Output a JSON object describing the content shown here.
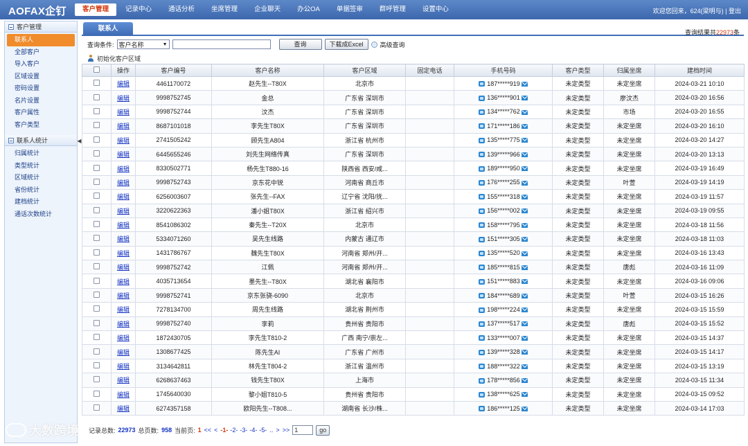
{
  "app": {
    "logo": "AOFAX企钉",
    "welcome": "欢迎您回来，624(梁明与) | 登出"
  },
  "nav": [
    "客户管理",
    "记录中心",
    "通话分析",
    "坐席管理",
    "企业聊天",
    "办公OA",
    "单据签审",
    "群呼管理",
    "设置中心"
  ],
  "sidebar": {
    "group1": {
      "title": "客户管理",
      "items": [
        "联系人",
        "全部客户",
        "导入客户",
        "区域设置",
        "密码设置",
        "名片设置",
        "客户属性",
        "客户类型"
      ]
    },
    "group2": {
      "title": "联系人统计",
      "items": [
        "归属统计",
        "类型统计",
        "区域统计",
        "省份统计",
        "建档统计",
        "通话次数统计"
      ]
    }
  },
  "tab": "联系人",
  "result": {
    "prefix": "查询结果共",
    "count": "22973",
    "suffix": "条"
  },
  "query": {
    "label": "查询条件:",
    "select": "客户名称",
    "query_btn": "查询",
    "excel_btn": "下载成Excel",
    "advanced": "高级查询"
  },
  "init_region": "初始化客户区域",
  "columns": [
    "操作",
    "客户编号",
    "客户名称",
    "客户区域",
    "固定电话",
    "手机号码",
    "客户类型",
    "归属坐席",
    "建档时间"
  ],
  "edit_label": "编辑",
  "rows": [
    [
      "4461170072",
      "赵先生--T80X",
      "北京市",
      "",
      "187*****919",
      "未定类型",
      "未定坐席",
      "2024-03-21 10:10"
    ],
    [
      "9998752745",
      "金总",
      "广东省 深圳市",
      "",
      "136*****901",
      "未定类型",
      "廖汶杰",
      "2024-03-20 16:56"
    ],
    [
      "9998752744",
      "汶杰",
      "广东省 深圳市",
      "",
      "134*****762",
      "未定类型",
      "市场",
      "2024-03-20 16:55"
    ],
    [
      "8687101018",
      "李先生T80X",
      "广东省 深圳市",
      "",
      "171*****186",
      "未定类型",
      "未定坐席",
      "2024-03-20 16:10"
    ],
    [
      "2741505242",
      "顾先生A804",
      "浙江省 杭州市",
      "",
      "135*****775",
      "未定类型",
      "未定坐席",
      "2024-03-20 14:27"
    ],
    [
      "6445655246",
      "刘先生网络传真",
      "广东省 深圳市",
      "",
      "139*****966",
      "未定类型",
      "未定坐席",
      "2024-03-20 13:13"
    ],
    [
      "8330502771",
      "杨先生T880-16",
      "陕西省 西安/咸...",
      "",
      "189*****950",
      "未定类型",
      "未定坐席",
      "2024-03-19 16:49"
    ],
    [
      "9998752743",
      "京东花中锐",
      "河南省 商丘市",
      "",
      "176*****255",
      "未定类型",
      "叶萱",
      "2024-03-19 14:19"
    ],
    [
      "6256003607",
      "张先生--FAX",
      "辽宁省 沈阳/抚...",
      "",
      "155*****318",
      "未定类型",
      "未定坐席",
      "2024-03-19 11:57"
    ],
    [
      "3220622363",
      "潘小姐T80X",
      "浙江省 绍兴市",
      "",
      "156*****002",
      "未定类型",
      "未定坐席",
      "2024-03-19 09:55"
    ],
    [
      "8541086302",
      "秦先生--T20X",
      "北京市",
      "",
      "158*****795",
      "未定类型",
      "未定坐席",
      "2024-03-18 11:56"
    ],
    [
      "5334071260",
      "吴先生线路",
      "内蒙古 通辽市",
      "",
      "151*****305",
      "未定类型",
      "未定坐席",
      "2024-03-18 11:03"
    ],
    [
      "1431786767",
      "魏先生T80X",
      "河南省 郑州/开...",
      "",
      "135*****520",
      "未定类型",
      "未定坐席",
      "2024-03-16 13:43"
    ],
    [
      "9998752742",
      "江佩",
      "河南省 郑州/开...",
      "",
      "185*****815",
      "未定类型",
      "唐彪",
      "2024-03-16 11:09"
    ],
    [
      "4035713654",
      "墨先生--T80X",
      "湖北省 襄阳市",
      "",
      "151*****883",
      "未定类型",
      "未定坐席",
      "2024-03-16 09:06"
    ],
    [
      "9998752741",
      "京东张骁-6090",
      "北京市",
      "",
      "184*****689",
      "未定类型",
      "叶萱",
      "2024-03-15 16:26"
    ],
    [
      "7278134700",
      "周先生线路",
      "湖北省 荆州市",
      "",
      "198*****224",
      "未定类型",
      "未定坐席",
      "2024-03-15 15:59"
    ],
    [
      "9998752740",
      "李莉",
      "贵州省 贵阳市",
      "",
      "137*****517",
      "未定类型",
      "唐彪",
      "2024-03-15 15:52"
    ],
    [
      "1872430705",
      "李先生T810-2",
      "广西 南宁/崇左...",
      "",
      "133*****007",
      "未定类型",
      "未定坐席",
      "2024-03-15 14:37"
    ],
    [
      "1308677425",
      "陈先生AI",
      "广东省 广州市",
      "",
      "139*****328",
      "未定类型",
      "未定坐席",
      "2024-03-15 14:17"
    ],
    [
      "3134642811",
      "林先生T804-2",
      "浙江省 温州市",
      "",
      "188*****322",
      "未定类型",
      "未定坐席",
      "2024-03-15 13:19"
    ],
    [
      "6268637463",
      "钱先生T80X",
      "上海市",
      "",
      "178*****856",
      "未定类型",
      "未定坐席",
      "2024-03-15 11:34"
    ],
    [
      "1745640030",
      "黎小姐T810-5",
      "贵州省 贵阳市",
      "",
      "138*****625",
      "未定类型",
      "未定坐席",
      "2024-03-15 09:52"
    ],
    [
      "6274357158",
      "欧阳先生--T808...",
      "湖南省 长沙/株...",
      "",
      "186*****125",
      "未定类型",
      "未定坐席",
      "2024-03-14 17:03"
    ]
  ],
  "pager": {
    "total_label": "记录总数:",
    "total": "22973",
    "pages_label": "总页数:",
    "pages": "958",
    "current_label": "当前页:",
    "current": "1",
    "first": "<<",
    "prev": "<",
    "page_links": [
      "-1-",
      "-2-",
      "-3-",
      "-4-",
      "-5-"
    ],
    "ellipsis": "..",
    "next": ">",
    "last": ">>",
    "input_value": "1",
    "go": "go"
  },
  "watermark": "大数跨境"
}
